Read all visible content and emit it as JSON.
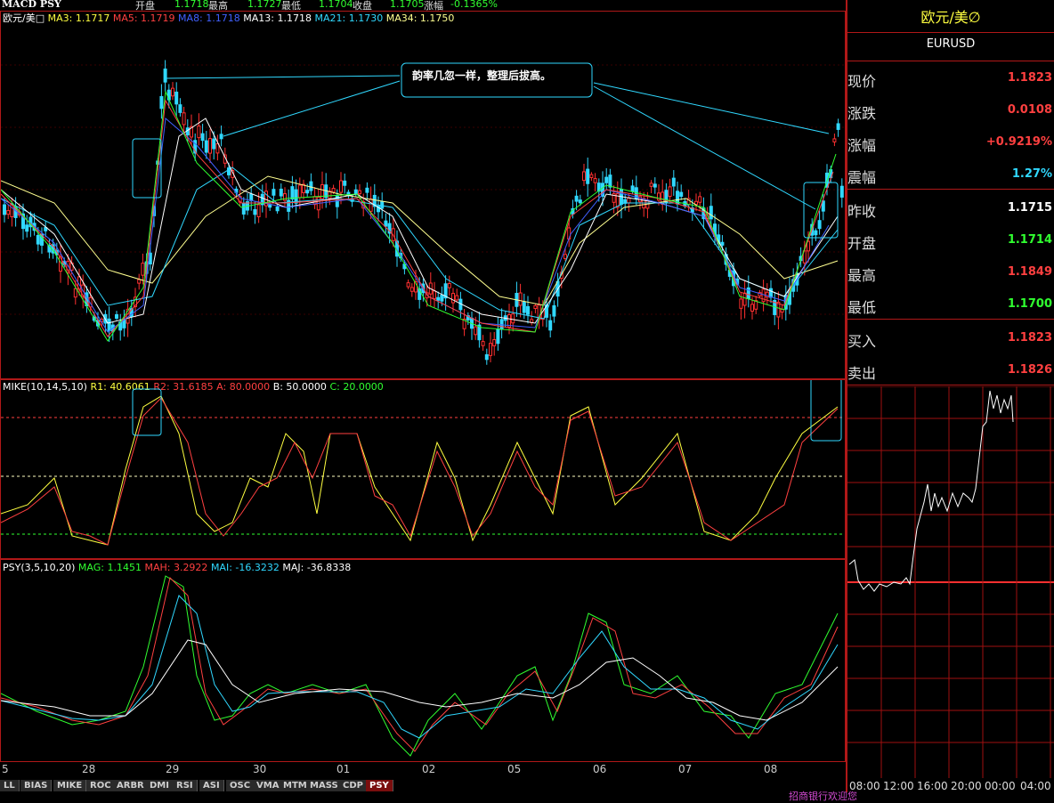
{
  "top_bar": {
    "name": "MACD PSY",
    "open_label": "开盘",
    "open_value": "1.1718",
    "high_label": "最高",
    "high_value": "1.1727",
    "low_label": "最低",
    "low_value": "1.1704",
    "close_label": "收盘",
    "close_value": "1.1705",
    "change_label": "涨幅",
    "change_value": "-0.1365%"
  },
  "main_chart": {
    "symbol": "欧元/美□",
    "ma3": "MA3: 1.1717",
    "ma5": "MA5: 1.1719",
    "ma8": "MA8: 1.1718",
    "ma13": "MA13: 1.1718",
    "ma21": "MA21: 1.1730",
    "ma34": "MA34: 1.1750",
    "annotation": "韵率几忽一样，整理后拔高。"
  },
  "mike_panel": {
    "name": "MIKE(10,14,5,10)",
    "r1": "R1: 40.6061",
    "r2": "R2: 31.6185",
    "a": "A: 80.0000",
    "b": "B: 50.0000",
    "c": "C: 20.0000"
  },
  "psy_panel": {
    "name": "PSY(3,5,10,20)",
    "mag": "MAG: 1.1451",
    "mah": "MAH: 3.2922",
    "mai": "MAI: -16.3232",
    "maj": "MAJ: -36.8338"
  },
  "x_axis": [
    "5",
    "28",
    "29",
    "30",
    "01",
    "02",
    "05",
    "06",
    "07",
    "08"
  ],
  "tabs": [
    "LL",
    "BIAS",
    "MIKE",
    "ROC",
    "ARBR",
    "DMI",
    "RSI",
    "ASI",
    "OSC",
    "VMA",
    "MTM",
    "MASS",
    "CDP",
    "PSY"
  ],
  "active_tab": "PSY",
  "right_panel": {
    "title": "欧元/美∅",
    "symbol": "EURUSD",
    "rows": [
      {
        "label": "现价",
        "value": "1.1823",
        "color": "#ff4040"
      },
      {
        "label": "涨跌",
        "value": "0.0108",
        "color": "#ff4040"
      },
      {
        "label": "涨幅",
        "value": "+0.9219%",
        "color": "#ff4040"
      },
      {
        "label": "震幅",
        "value": "1.27%",
        "color": "#30d8ff"
      },
      {
        "label": "昨收",
        "value": "1.1715",
        "color": "#ffffff"
      },
      {
        "label": "开盘",
        "value": "1.1714",
        "color": "#30ff30"
      },
      {
        "label": "最高",
        "value": "1.1849",
        "color": "#ff4040"
      },
      {
        "label": "最低",
        "value": "1.1700",
        "color": "#30ff30"
      },
      {
        "label": "买入",
        "value": "1.1823",
        "color": "#ff4040"
      },
      {
        "label": "卖出",
        "value": "1.1826",
        "color": "#ff4040"
      }
    ],
    "time_axis": [
      "08:00",
      "12:00",
      "16:00",
      "20:00",
      "00:00",
      "04:00"
    ]
  },
  "status_text": "招商银行欢迎您"
}
